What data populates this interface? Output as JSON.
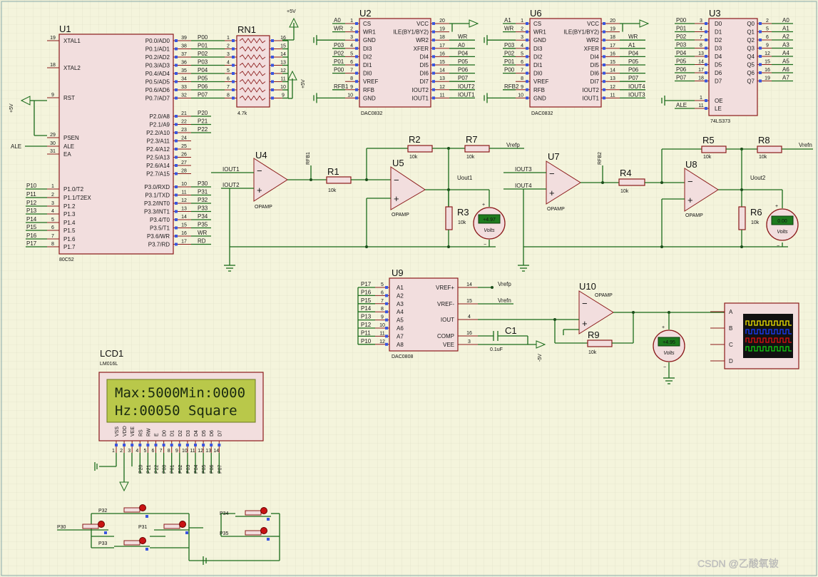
{
  "grid": {
    "color": "#d8d8c0",
    "background": "#f4f4dc"
  },
  "colors": {
    "wire": "#1a6b1a",
    "component_body": "#f2dede",
    "component_border": "#8b1a1a",
    "lcd_background": "#b9c84a",
    "meter_display": "#1e7a1e",
    "pin_marker": "#3a55e0"
  },
  "u1": {
    "ref": "U1",
    "part": "80C52",
    "left_pins": [
      {
        "num": "19",
        "name": "XTAL1"
      },
      {
        "num": "18",
        "name": "XTAL2"
      },
      {
        "num": "9",
        "name": "RST"
      },
      {
        "num": "29",
        "name": "PSEN"
      },
      {
        "num": "30",
        "name": "ALE"
      },
      {
        "num": "31",
        "name": "EA"
      },
      {
        "num": "1",
        "name": "P1.0/T2"
      },
      {
        "num": "2",
        "name": "P1.1/T2EX"
      },
      {
        "num": "3",
        "name": "P1.2"
      },
      {
        "num": "4",
        "name": "P1.3"
      },
      {
        "num": "5",
        "name": "P1.4"
      },
      {
        "num": "6",
        "name": "P1.5"
      },
      {
        "num": "7",
        "name": "P1.6"
      },
      {
        "num": "8",
        "name": "P1.7"
      }
    ],
    "left_nets": [
      "P10",
      "P11",
      "P12",
      "P13",
      "P14",
      "P15",
      "P16",
      "P17"
    ],
    "right_pins": [
      {
        "num": "39",
        "name": "P0.0/AD0",
        "net": "P00"
      },
      {
        "num": "38",
        "name": "P0.1/AD1",
        "net": "P01"
      },
      {
        "num": "37",
        "name": "P0.2/AD2",
        "net": "P02"
      },
      {
        "num": "36",
        "name": "P0.3/AD3",
        "net": "P03"
      },
      {
        "num": "35",
        "name": "P0.4/AD4",
        "net": "P04"
      },
      {
        "num": "34",
        "name": "P0.5/AD5",
        "net": "P05"
      },
      {
        "num": "33",
        "name": "P0.6/AD6",
        "net": "P06"
      },
      {
        "num": "32",
        "name": "P0.7/AD7",
        "net": "P07"
      },
      {
        "num": "21",
        "name": "P2.0/A8",
        "net": "P20"
      },
      {
        "num": "22",
        "name": "P2.1/A9",
        "net": "P21"
      },
      {
        "num": "23",
        "name": "P2.2/A10",
        "net": "P22"
      },
      {
        "num": "24",
        "name": "P2.3/A11",
        "net": ""
      },
      {
        "num": "25",
        "name": "P2.4/A12",
        "net": ""
      },
      {
        "num": "26",
        "name": "P2.5/A13",
        "net": ""
      },
      {
        "num": "27",
        "name": "P2.6/A14",
        "net": ""
      },
      {
        "num": "28",
        "name": "P2.7/A15",
        "net": ""
      },
      {
        "num": "10",
        "name": "P3.0/RXD",
        "net": "P30"
      },
      {
        "num": "11",
        "name": "P3.1/TXD",
        "net": "P31"
      },
      {
        "num": "12",
        "name": "P3.2/INT0",
        "net": "P32"
      },
      {
        "num": "13",
        "name": "P3.3/INT1",
        "net": "P33"
      },
      {
        "num": "14",
        "name": "P3.4/T0",
        "net": "P34"
      },
      {
        "num": "15",
        "name": "P3.5/T1",
        "net": "P35"
      },
      {
        "num": "16",
        "name": "P3.6/WR",
        "net": "WR"
      },
      {
        "num": "17",
        "name": "P3.7/RD",
        "net": "RD"
      }
    ],
    "rst_supply": "+5V",
    "ale_label": "ALE"
  },
  "rn1": {
    "ref": "RN1",
    "value": "4.7k",
    "left_nums": [
      "1",
      "2",
      "3",
      "4",
      "5",
      "6",
      "7",
      "8"
    ],
    "right_nums": [
      "16",
      "15",
      "14",
      "13",
      "12",
      "11",
      "10",
      "9"
    ],
    "supply": "+5V"
  },
  "supply_top": "+5V",
  "u2": {
    "ref": "U2",
    "part": "DAC0832",
    "left_pins": [
      {
        "net": "A0",
        "num": "1",
        "name": "CS"
      },
      {
        "net": "WR",
        "num": "2",
        "name": "WR1"
      },
      {
        "net": "",
        "num": "3",
        "name": "GND"
      },
      {
        "net": "P03",
        "num": "4",
        "name": "DI3"
      },
      {
        "net": "P02",
        "num": "5",
        "name": "DI2"
      },
      {
        "net": "P01",
        "num": "6",
        "name": "DI1"
      },
      {
        "net": "P00",
        "num": "7",
        "name": "DI0"
      },
      {
        "net": "",
        "num": "8",
        "name": "VREF"
      },
      {
        "net": "RFB1",
        "num": "9",
        "name": "RFB"
      },
      {
        "net": "",
        "num": "10",
        "name": "GND"
      }
    ],
    "right_pins": [
      {
        "num": "20",
        "name": "VCC",
        "net": ""
      },
      {
        "num": "19",
        "name": "ILE(BY1/BY2)",
        "net": ""
      },
      {
        "num": "18",
        "name": "WR2",
        "net": "WR"
      },
      {
        "num": "17",
        "name": "XFER",
        "net": "A0"
      },
      {
        "num": "16",
        "name": "DI4",
        "net": "P04"
      },
      {
        "num": "15",
        "name": "DI5",
        "net": "P05"
      },
      {
        "num": "14",
        "name": "DI6",
        "net": "P06"
      },
      {
        "num": "13",
        "name": "DI7",
        "net": "P07"
      },
      {
        "num": "12",
        "name": "IOUT2",
        "net": "IOUT2"
      },
      {
        "num": "11",
        "name": "IOUT1",
        "net": "IOUT1"
      }
    ]
  },
  "u6": {
    "ref": "U6",
    "part": "DAC0832",
    "left_pins": [
      {
        "net": "A1",
        "num": "1",
        "name": "CS"
      },
      {
        "net": "WR",
        "num": "2",
        "name": "WR1"
      },
      {
        "net": "",
        "num": "3",
        "name": "GND"
      },
      {
        "net": "P03",
        "num": "4",
        "name": "DI3"
      },
      {
        "net": "P02",
        "num": "5",
        "name": "DI2"
      },
      {
        "net": "P01",
        "num": "6",
        "name": "DI1"
      },
      {
        "net": "P00",
        "num": "7",
        "name": "DI0"
      },
      {
        "net": "",
        "num": "8",
        "name": "VREF"
      },
      {
        "net": "RFB2",
        "num": "9",
        "name": "RFB"
      },
      {
        "net": "",
        "num": "10",
        "name": "GND"
      }
    ],
    "right_pins": [
      {
        "num": "20",
        "name": "VCC",
        "net": ""
      },
      {
        "num": "19",
        "name": "ILE(BY1/BY2)",
        "net": ""
      },
      {
        "num": "18",
        "name": "WR2",
        "net": "WR"
      },
      {
        "num": "17",
        "name": "XFER",
        "net": "A1"
      },
      {
        "num": "16",
        "name": "DI4",
        "net": "P04"
      },
      {
        "num": "15",
        "name": "DI5",
        "net": "P05"
      },
      {
        "num": "14",
        "name": "DI6",
        "net": "P06"
      },
      {
        "num": "13",
        "name": "DI7",
        "net": "P07"
      },
      {
        "num": "12",
        "name": "IOUT2",
        "net": "IOUT4"
      },
      {
        "num": "11",
        "name": "IOUT1",
        "net": "IOUT3"
      }
    ]
  },
  "u3": {
    "ref": "U3",
    "part": "74LS373",
    "left_pins": [
      {
        "net": "P00",
        "num": "3",
        "name": "D0"
      },
      {
        "net": "P01",
        "num": "4",
        "name": "D1"
      },
      {
        "net": "P02",
        "num": "7",
        "name": "D2"
      },
      {
        "net": "P03",
        "num": "8",
        "name": "D3"
      },
      {
        "net": "P04",
        "num": "13",
        "name": "D4"
      },
      {
        "net": "P05",
        "num": "14",
        "name": "D5"
      },
      {
        "net": "P06",
        "num": "17",
        "name": "D6"
      },
      {
        "net": "P07",
        "num": "18",
        "name": "D7"
      },
      {
        "net": "",
        "num": "1",
        "name": "OE"
      },
      {
        "net": "ALE",
        "num": "11",
        "name": "LE"
      }
    ],
    "right_pins": [
      {
        "num": "2",
        "name": "Q0",
        "net": "A0"
      },
      {
        "num": "5",
        "name": "Q1",
        "net": "A1"
      },
      {
        "num": "6",
        "name": "Q2",
        "net": "A2"
      },
      {
        "num": "9",
        "name": "Q3",
        "net": "A3"
      },
      {
        "num": "12",
        "name": "Q4",
        "net": "A4"
      },
      {
        "num": "15",
        "name": "Q5",
        "net": "A5"
      },
      {
        "num": "16",
        "name": "Q6",
        "net": "A6"
      },
      {
        "num": "19",
        "name": "Q7",
        "net": "A7"
      }
    ]
  },
  "analog": {
    "opamp_label": "OPAMP",
    "u4": "U4",
    "u5": "U5",
    "u7": "U7",
    "u8": "U8",
    "u10": "U10",
    "r1": {
      "ref": "R1",
      "value": "10k"
    },
    "r2": {
      "ref": "R2",
      "value": "10k"
    },
    "r3": {
      "ref": "R3",
      "value": "10k"
    },
    "r4": {
      "ref": "R4",
      "value": "10k"
    },
    "r5": {
      "ref": "R5",
      "value": "10k"
    },
    "r6": {
      "ref": "R6",
      "value": "10k"
    },
    "r7": {
      "ref": "R7",
      "value": "10k"
    },
    "r8": {
      "ref": "R8",
      "value": "10k"
    },
    "r9": {
      "ref": "R9",
      "value": "10k"
    },
    "c1": {
      "ref": "C1",
      "value": "0.1uF"
    },
    "iout1": "IOUT1",
    "iout2": "IOUT2",
    "iout3": "IOUT3",
    "iout4": "IOUT4",
    "rfb1": "RFB1",
    "rfb2": "RFB2",
    "uout1": "Uout1",
    "uout2": "Uout2",
    "vrefp": "Vrefp",
    "vrefn": "Vrefn",
    "neg5v": "-5V"
  },
  "meters": [
    {
      "id": "m1",
      "reading": "+4.97",
      "unit": "Volts"
    },
    {
      "id": "m2",
      "reading": "0.00",
      "unit": "Volts"
    },
    {
      "id": "m3",
      "reading": "+4.95",
      "unit": "Volts"
    }
  ],
  "u9": {
    "ref": "U9",
    "part": "DAC0808",
    "left_pins": [
      {
        "net": "P17",
        "num": "5",
        "name": "A1"
      },
      {
        "net": "P16",
        "num": "6",
        "name": "A2"
      },
      {
        "net": "P15",
        "num": "7",
        "name": "A3"
      },
      {
        "net": "P14",
        "num": "8",
        "name": "A4"
      },
      {
        "net": "P13",
        "num": "9",
        "name": "A5"
      },
      {
        "net": "P12",
        "num": "10",
        "name": "A6"
      },
      {
        "net": "P11",
        "num": "11",
        "name": "A7"
      },
      {
        "net": "P10",
        "num": "12",
        "name": "A8"
      }
    ],
    "right_pins": [
      {
        "num": "14",
        "name": "VREF+",
        "net": "Vrefp"
      },
      {
        "num": "15",
        "name": "VREF-",
        "net": "Vrefn"
      },
      {
        "num": "4",
        "name": "IOUT",
        "net": ""
      },
      {
        "num": "16",
        "name": "COMP",
        "net": ""
      },
      {
        "num": "3",
        "name": "VEE",
        "net": ""
      }
    ]
  },
  "scope": {
    "channels": [
      "A",
      "B",
      "C",
      "D"
    ],
    "trace_colors": [
      "#f2e600",
      "#1a3cff",
      "#e01010",
      "#10d010"
    ]
  },
  "lcd": {
    "ref": "LCD1",
    "part": "LM016L",
    "line1": "Max:5000Min:0000",
    "line2": "Hz:00050 Square",
    "pin_names": [
      "VSS",
      "VDD",
      "VEE",
      "RS",
      "RW",
      "E",
      "D0",
      "D1",
      "D2",
      "D3",
      "D4",
      "D5",
      "D6",
      "D7"
    ],
    "pin_nums": [
      "1",
      "2",
      "3",
      "4",
      "5",
      "6",
      "7",
      "8",
      "9",
      "10",
      "11",
      "12",
      "13",
      "14"
    ],
    "pin_nets": [
      "",
      "",
      "",
      "P20",
      "P21",
      "P22",
      "P00",
      "P01",
      "P02",
      "P03",
      "P04",
      "P05",
      "P06",
      "P07"
    ]
  },
  "buttons": [
    {
      "label": "P32"
    },
    {
      "label": "P30"
    },
    {
      "label": "P31"
    },
    {
      "label": "P33"
    },
    {
      "label": "P34"
    },
    {
      "label": "P35"
    }
  ],
  "watermark": "CSDN @乙酸氧铍"
}
